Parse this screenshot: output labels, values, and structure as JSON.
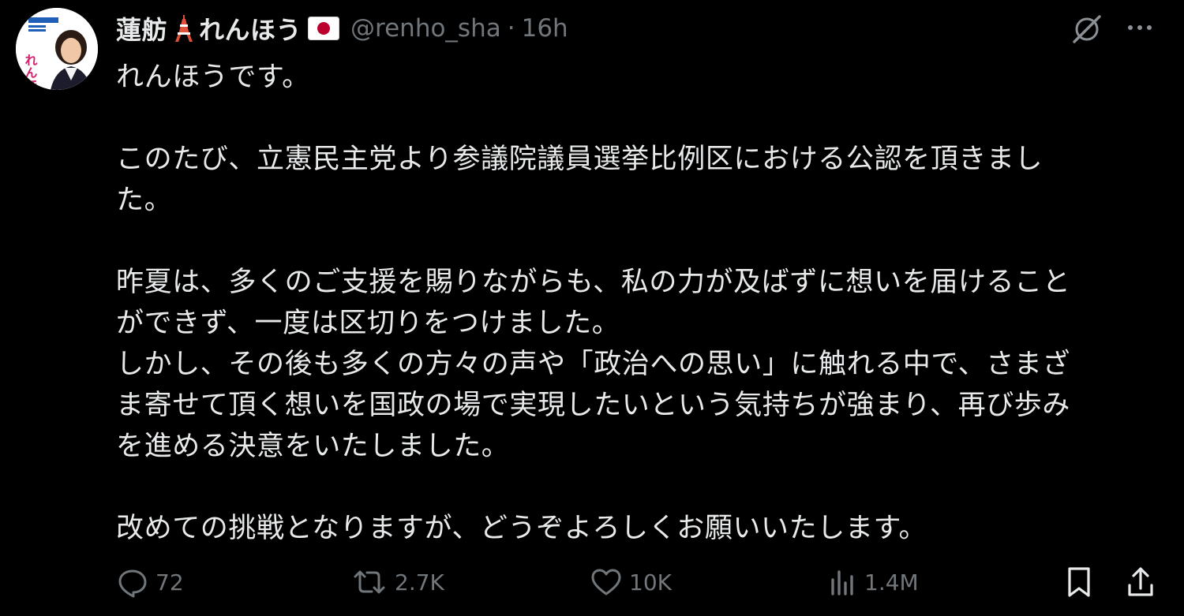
{
  "author": {
    "display_name": "蓮舫",
    "display_name_suffix": "れんほう",
    "handle": "@renho_sha",
    "separator": "·",
    "time": "16h",
    "avatar_poster_text": "れんほう",
    "avatar_icon": "profile-photo",
    "tower_emoji": "tokyo-tower",
    "flag_emoji": "japan-flag"
  },
  "tweet": {
    "lines": [
      "れんほうです。",
      "",
      "このたび、立憲民主党より参議院議員選挙比例区における公認を頂きまし",
      "た。",
      "",
      "昨夏は、多くのご支援を賜りながらも、私の力が及ばずに想いを届けること",
      "ができず、一度は区切りをつけました。",
      "しかし、その後も多くの方々の声や「政治への思い」に触れる中で、さまざ",
      "ま寄せて頂く想いを国政の場で実現したいという気持ちが強まり、再び歩み",
      "を進める決意をいたしました。",
      "",
      "改めての挑戦となりますが、どうぞよろしくお願いいたします。"
    ]
  },
  "actions": {
    "reply_count": "72",
    "repost_count": "2.7K",
    "like_count": "10K",
    "views_count": "1.4M"
  },
  "icons": {
    "grok": "grok-icon",
    "more": "more-icon",
    "reply": "reply-icon",
    "repost": "repost-icon",
    "like": "heart-icon",
    "views": "analytics-icon",
    "bookmark": "bookmark-icon",
    "share": "share-icon"
  },
  "colors": {
    "background": "#000000",
    "text_primary": "#e7e9ea",
    "text_secondary": "#71767b",
    "flag_red": "#bc002d",
    "tower_red": "#e0503a"
  }
}
